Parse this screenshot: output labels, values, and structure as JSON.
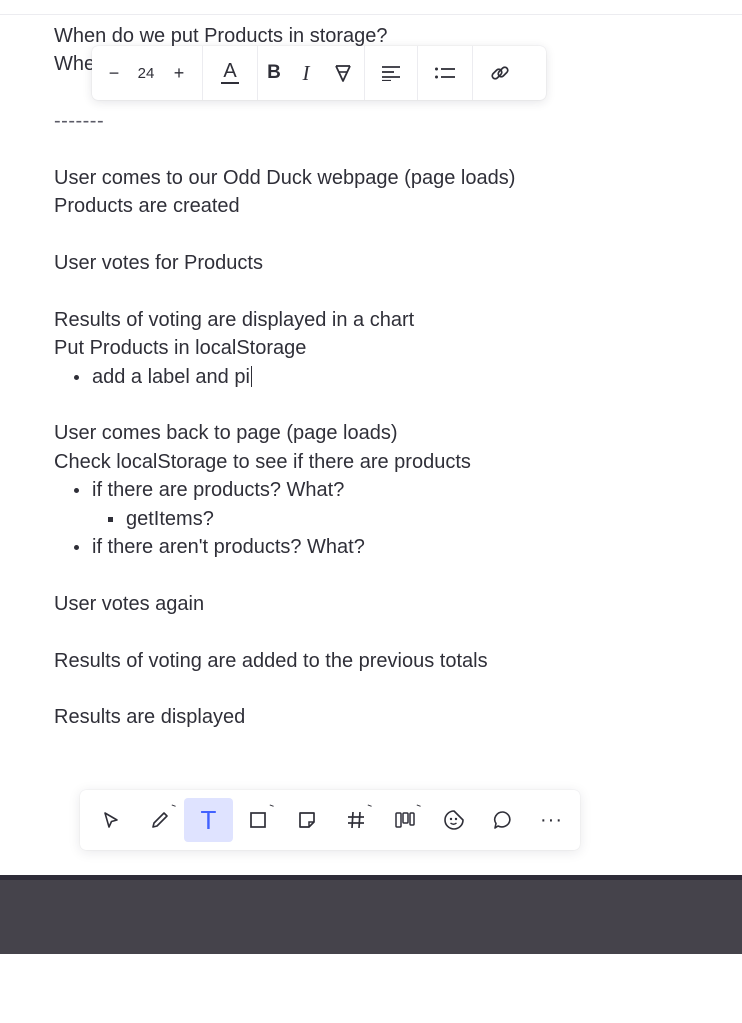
{
  "note": {
    "lines": [
      {
        "type": "text",
        "text": "When do we put Products in storage?"
      },
      {
        "type": "text",
        "text": "Whe"
      },
      {
        "type": "blank"
      },
      {
        "type": "dashes",
        "text": "-------"
      },
      {
        "type": "blank"
      },
      {
        "type": "text",
        "text": "User comes to our Odd Duck webpage (page loads)"
      },
      {
        "type": "text",
        "text": "Products are created"
      },
      {
        "type": "blank"
      },
      {
        "type": "text",
        "text": "User votes for Products"
      },
      {
        "type": "blank"
      },
      {
        "type": "text",
        "text": "Results of voting are displayed in a chart"
      },
      {
        "type": "text",
        "text": "Put Products in localStorage"
      },
      {
        "type": "bullet",
        "text": "add a label and pi",
        "caret": true
      },
      {
        "type": "blank"
      },
      {
        "type": "text",
        "text": "User comes back to page (page loads)"
      },
      {
        "type": "text",
        "text": "Check localStorage to see if there are products"
      },
      {
        "type": "bullet",
        "text": "if there are products? What?"
      },
      {
        "type": "bullet2",
        "text": "getItems?"
      },
      {
        "type": "bullet",
        "text": "if there aren't products? What?"
      },
      {
        "type": "blank"
      },
      {
        "type": "text",
        "text": "User votes again"
      },
      {
        "type": "blank"
      },
      {
        "type": "text",
        "text": "Results of voting are added to the previous totals"
      },
      {
        "type": "blank"
      },
      {
        "type": "text",
        "text": "Results are displayed"
      }
    ]
  },
  "format_toolbar": {
    "decrease_label": "−",
    "font_size": "24",
    "increase_label": "+",
    "color_label": "A",
    "bold_label": "B",
    "italic_label": "I"
  },
  "tool_dock": {
    "tools": [
      {
        "name": "select-tool",
        "icon": "cursor-icon",
        "active": false
      },
      {
        "name": "pen-tool",
        "icon": "pen-icon",
        "active": false,
        "has_submenu": true
      },
      {
        "name": "text-tool",
        "icon": "text-icon",
        "active": true,
        "label": "T"
      },
      {
        "name": "shape-tool",
        "icon": "square-icon",
        "active": false,
        "has_submenu": true
      },
      {
        "name": "sticky-note-tool",
        "icon": "sticky-note-icon",
        "active": false
      },
      {
        "name": "frame-tool",
        "icon": "hash-icon",
        "active": false,
        "has_submenu": true
      },
      {
        "name": "templates-tool",
        "icon": "kanban-icon",
        "active": false,
        "has_submenu": true
      },
      {
        "name": "sticker-tool",
        "icon": "sticker-icon",
        "active": false
      },
      {
        "name": "comment-tool",
        "icon": "comment-icon",
        "active": false
      },
      {
        "name": "more-tool",
        "icon": "more-icon",
        "active": false,
        "label": "···"
      }
    ]
  },
  "colors": {
    "text": "#2f2f38",
    "accent": "#4262ff",
    "active_tool_bg": "#dfe3ff",
    "bottom_bar": "#45434b"
  }
}
